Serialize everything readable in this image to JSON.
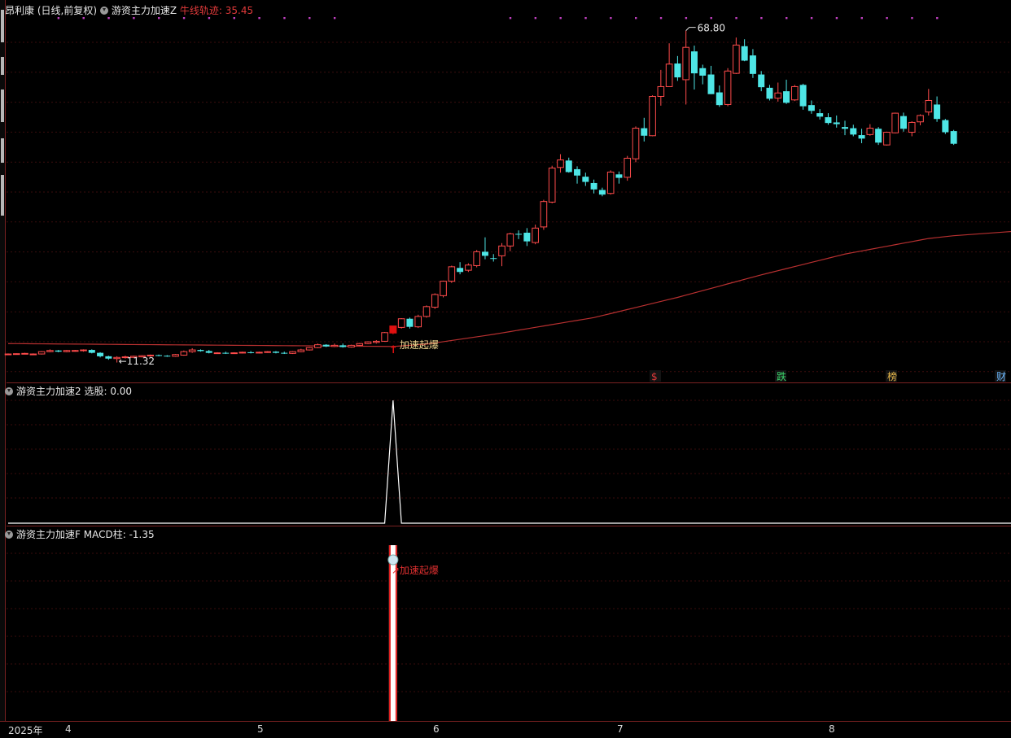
{
  "header": {
    "stock_name": "昂利康",
    "period": "(日线,前复权)",
    "indicator": "游资主力加速Z",
    "line_label": "牛线轨迹: 35.45"
  },
  "pane2": {
    "title": "游资主力加速2",
    "value_label": "选股: 0.00"
  },
  "pane3": {
    "title": "游资主力加速F",
    "value_label": "MACD柱: -1.35"
  },
  "annotations": {
    "high": "68.80",
    "low": "11.32",
    "signal": "加速起爆",
    "signal_bottom": "加速起爆"
  },
  "event_tags": [
    {
      "text": "$",
      "color": "#e03a3a"
    },
    {
      "text": "跌",
      "color": "#39d66a"
    },
    {
      "text": "榜",
      "color": "#e8b84a"
    },
    {
      "text": "财",
      "color": "#6bb8ff"
    }
  ],
  "xaxis": {
    "year": "2025年",
    "months": [
      "4",
      "5",
      "6",
      "7",
      "8"
    ]
  },
  "colors": {
    "up": "#ff4b4b",
    "down": "#4ee6e6",
    "ma": "#b83030",
    "signal": "#e01010",
    "grid": "#3a0d0d",
    "dots": "#c040c0"
  },
  "chart_data": {
    "type": "candlestick",
    "ylim": [
      9,
      71
    ],
    "ohlc": [
      [
        12.8,
        12.9,
        12.7,
        12.8
      ],
      [
        12.8,
        12.9,
        12.7,
        12.85
      ],
      [
        12.85,
        13.0,
        12.8,
        12.9
      ],
      [
        12.7,
        12.9,
        12.6,
        12.8
      ],
      [
        12.8,
        13.3,
        12.7,
        13.2
      ],
      [
        13.2,
        13.6,
        13.1,
        13.4
      ],
      [
        13.4,
        13.5,
        13.1,
        13.2
      ],
      [
        13.2,
        13.5,
        13.1,
        13.4
      ],
      [
        13.3,
        13.5,
        13.2,
        13.4
      ],
      [
        13.4,
        13.6,
        13.2,
        13.5
      ],
      [
        13.5,
        13.6,
        12.9,
        13.0
      ],
      [
        13.0,
        13.1,
        12.2,
        12.4
      ],
      [
        12.4,
        12.5,
        11.8,
        12.0
      ],
      [
        12.0,
        12.4,
        11.32,
        12.2
      ],
      [
        12.2,
        12.5,
        12.0,
        12.3
      ],
      [
        12.2,
        12.5,
        12.1,
        12.4
      ],
      [
        12.3,
        12.6,
        12.2,
        12.5
      ],
      [
        12.5,
        12.7,
        12.3,
        12.6
      ],
      [
        12.6,
        12.7,
        12.4,
        12.5
      ],
      [
        12.5,
        12.6,
        12.3,
        12.4
      ],
      [
        12.4,
        12.8,
        12.3,
        12.7
      ],
      [
        12.6,
        13.4,
        12.5,
        13.2
      ],
      [
        13.2,
        13.8,
        13.0,
        13.5
      ],
      [
        13.5,
        13.6,
        13.2,
        13.3
      ],
      [
        13.3,
        13.5,
        12.9,
        13.0
      ],
      [
        12.9,
        13.1,
        12.8,
        13.0
      ],
      [
        13.0,
        13.2,
        12.8,
        12.9
      ],
      [
        12.9,
        13.1,
        12.8,
        13.0
      ],
      [
        13.0,
        13.2,
        12.9,
        13.1
      ],
      [
        13.1,
        13.3,
        12.9,
        13.0
      ],
      [
        13.0,
        13.2,
        12.9,
        13.1
      ],
      [
        13.1,
        13.3,
        13.0,
        13.2
      ],
      [
        13.2,
        13.3,
        12.9,
        13.0
      ],
      [
        13.0,
        13.2,
        12.8,
        12.9
      ],
      [
        12.9,
        13.3,
        12.8,
        13.2
      ],
      [
        13.2,
        13.7,
        13.1,
        13.5
      ],
      [
        13.5,
        14.0,
        13.4,
        13.9
      ],
      [
        13.9,
        14.6,
        13.8,
        14.4
      ],
      [
        14.4,
        14.5,
        14.0,
        14.1
      ],
      [
        14.1,
        14.6,
        14.0,
        14.3
      ],
      [
        14.3,
        14.6,
        13.9,
        14.0
      ],
      [
        14.0,
        14.4,
        13.9,
        14.3
      ],
      [
        14.3,
        14.7,
        14.2,
        14.6
      ],
      [
        14.6,
        15.0,
        14.5,
        14.9
      ],
      [
        14.8,
        15.2,
        14.6,
        15.0
      ],
      [
        15.0,
        16.6,
        14.9,
        16.5
      ],
      [
        16.5,
        17.4,
        16.2,
        17.3
      ],
      [
        17.4,
        19.0,
        17.2,
        18.9
      ],
      [
        18.9,
        19.1,
        17.2,
        17.5
      ],
      [
        17.5,
        19.6,
        17.3,
        19.3
      ],
      [
        19.3,
        21.2,
        19.1,
        21.0
      ],
      [
        20.9,
        23.3,
        20.6,
        23.1
      ],
      [
        22.9,
        25.5,
        22.6,
        25.4
      ],
      [
        25.4,
        28.1,
        25.1,
        27.9
      ],
      [
        27.7,
        28.7,
        26.6,
        27.0
      ],
      [
        27.3,
        28.5,
        27.0,
        28.2
      ],
      [
        28.1,
        30.8,
        27.8,
        30.5
      ],
      [
        30.5,
        33.0,
        29.2,
        29.8
      ],
      [
        29.4,
        30.1,
        28.8,
        29.3
      ],
      [
        29.8,
        32.0,
        28.0,
        31.5
      ],
      [
        31.5,
        33.8,
        30.6,
        33.6
      ],
      [
        33.6,
        34.2,
        32.7,
        33.5
      ],
      [
        33.8,
        34.6,
        31.5,
        32.3
      ],
      [
        32.1,
        35.2,
        31.8,
        34.6
      ],
      [
        34.8,
        39.5,
        34.3,
        39.2
      ],
      [
        39.1,
        45.4,
        38.9,
        45.0
      ],
      [
        45.1,
        47.4,
        44.2,
        46.4
      ],
      [
        46.3,
        46.8,
        44.2,
        44.3
      ],
      [
        44.8,
        45.3,
        42.3,
        43.7
      ],
      [
        43.5,
        44.2,
        41.9,
        42.6
      ],
      [
        42.4,
        43.0,
        40.6,
        41.3
      ],
      [
        41.2,
        41.6,
        40.1,
        40.4
      ],
      [
        40.6,
        44.6,
        40.4,
        44.3
      ],
      [
        43.9,
        44.4,
        42.3,
        43.3
      ],
      [
        43.4,
        47.1,
        42.8,
        46.7
      ],
      [
        46.6,
        52.2,
        46.0,
        51.9
      ],
      [
        51.9,
        53.7,
        49.6,
        50.6
      ],
      [
        50.6,
        57.6,
        50.5,
        57.4
      ],
      [
        57.4,
        62.0,
        55.8,
        59.1
      ],
      [
        59.1,
        66.6,
        59.1,
        63.0
      ],
      [
        63.1,
        64.4,
        60.1,
        60.7
      ],
      [
        60.3,
        68.8,
        56.0,
        65.9
      ],
      [
        65.2,
        66.2,
        58.6,
        61.4
      ],
      [
        62.3,
        62.9,
        59.5,
        61.0
      ],
      [
        61.2,
        62.7,
        57.8,
        57.8
      ],
      [
        58.1,
        59.3,
        55.6,
        55.9
      ],
      [
        56.0,
        62.3,
        55.7,
        61.8
      ],
      [
        61.4,
        67.6,
        61.3,
        66.3
      ],
      [
        66.1,
        67.3,
        63.5,
        63.6
      ],
      [
        64.5,
        65.6,
        60.6,
        61.3
      ],
      [
        61.2,
        61.8,
        58.3,
        59.0
      ],
      [
        58.9,
        59.4,
        56.7,
        57.0
      ],
      [
        57.1,
        59.8,
        56.5,
        58.0
      ],
      [
        58.3,
        60.3,
        56.1,
        56.3
      ],
      [
        56.8,
        59.4,
        56.6,
        59.1
      ],
      [
        59.4,
        59.6,
        55.1,
        55.7
      ],
      [
        55.9,
        56.7,
        54.4,
        54.9
      ],
      [
        54.5,
        55.2,
        53.4,
        53.9
      ],
      [
        53.8,
        54.5,
        52.5,
        52.8
      ],
      [
        52.9,
        54.1,
        52.0,
        52.6
      ],
      [
        52.1,
        53.2,
        50.7,
        51.8
      ],
      [
        51.9,
        52.5,
        50.5,
        50.8
      ],
      [
        50.7,
        51.8,
        49.3,
        50.1
      ],
      [
        50.8,
        52.6,
        50.6,
        51.9
      ],
      [
        51.8,
        52.1,
        49.0,
        49.4
      ],
      [
        49.0,
        51.3,
        48.9,
        51.2
      ],
      [
        51.1,
        54.6,
        51.0,
        54.5
      ],
      [
        54.0,
        54.6,
        51.3,
        51.8
      ],
      [
        51.2,
        53.1,
        50.5,
        52.9
      ],
      [
        53.0,
        54.3,
        52.4,
        54.1
      ],
      [
        54.7,
        58.7,
        54.1,
        56.7
      ],
      [
        56.0,
        57.4,
        53.0,
        53.5
      ],
      [
        53.3,
        53.5,
        50.9,
        51.2
      ],
      [
        51.4,
        51.6,
        49.0,
        49.2
      ]
    ],
    "ma": {
      "name": "牛线轨迹",
      "anchors": [
        [
          0,
          14.6
        ],
        [
          46,
          14.1
        ],
        [
          50,
          14.5
        ],
        [
          58,
          16.2
        ],
        [
          70,
          19.1
        ],
        [
          80,
          22.6
        ],
        [
          90,
          26.5
        ],
        [
          100,
          30.1
        ],
        [
          110,
          32.8
        ],
        [
          115,
          33.6
        ]
      ]
    },
    "signal_index": 46,
    "pane2": {
      "label": "选股",
      "values_nonzero": [
        [
          46,
          1
        ]
      ],
      "ylim": [
        0,
        1
      ]
    },
    "pane3": {
      "label": "MACD柱",
      "bar_index": 46
    }
  }
}
